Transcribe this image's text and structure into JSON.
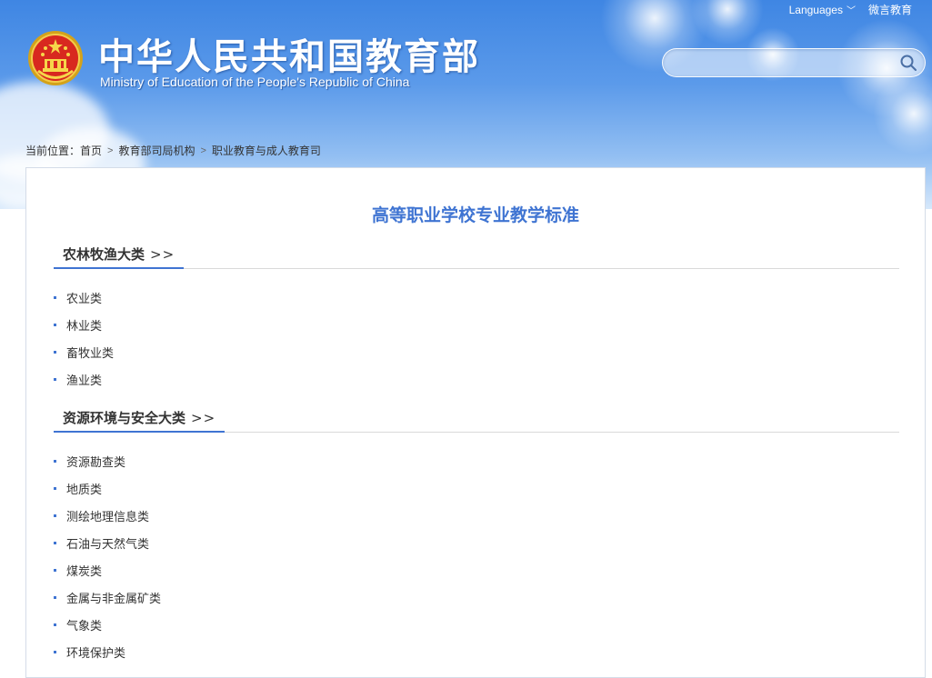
{
  "header": {
    "title": "中华人民共和国教育部",
    "subtitle": "Ministry of Education of the People's Republic of China",
    "languages_label": "Languages",
    "weibo_label": "微言教育",
    "search_placeholder": ""
  },
  "breadcrumb": {
    "prefix": "当前位置：",
    "items": [
      "首页",
      "教育部司局机构",
      "职业教育与成人教育司"
    ]
  },
  "page": {
    "title": "高等职业学校专业教学标准"
  },
  "sections": [
    {
      "title": "农林牧渔大类",
      "arrows": ">>",
      "items": [
        "农业类",
        "林业类",
        "畜牧业类",
        "渔业类"
      ]
    },
    {
      "title": "资源环境与安全大类",
      "arrows": ">>",
      "items": [
        "资源勘查类",
        "地质类",
        "测绘地理信息类",
        "石油与天然气类",
        "煤炭类",
        "金属与非金属矿类",
        "气象类",
        "环境保护类"
      ]
    }
  ],
  "colors": {
    "accent": "#3f74d2",
    "header_top": "#3f86e3"
  }
}
